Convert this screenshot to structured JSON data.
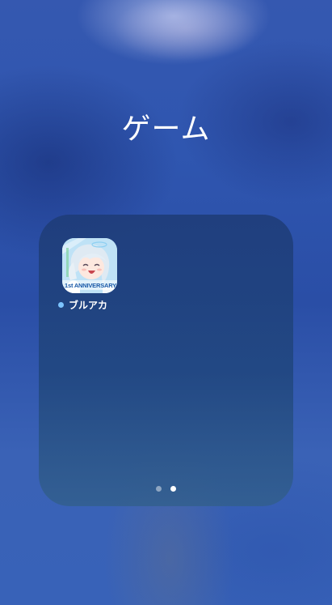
{
  "folder": {
    "title": "ゲーム",
    "apps": [
      {
        "label": "ブルアカ",
        "icon": "blue-archive-app-icon",
        "icon_badge_text": "1st ANNIVERSARY",
        "has_new_indicator": true
      }
    ],
    "page_indicator": {
      "page_count": 2,
      "current_page": 2
    }
  },
  "colors": {
    "new_dot": "#7cc4ff",
    "title": "#ffffff"
  }
}
